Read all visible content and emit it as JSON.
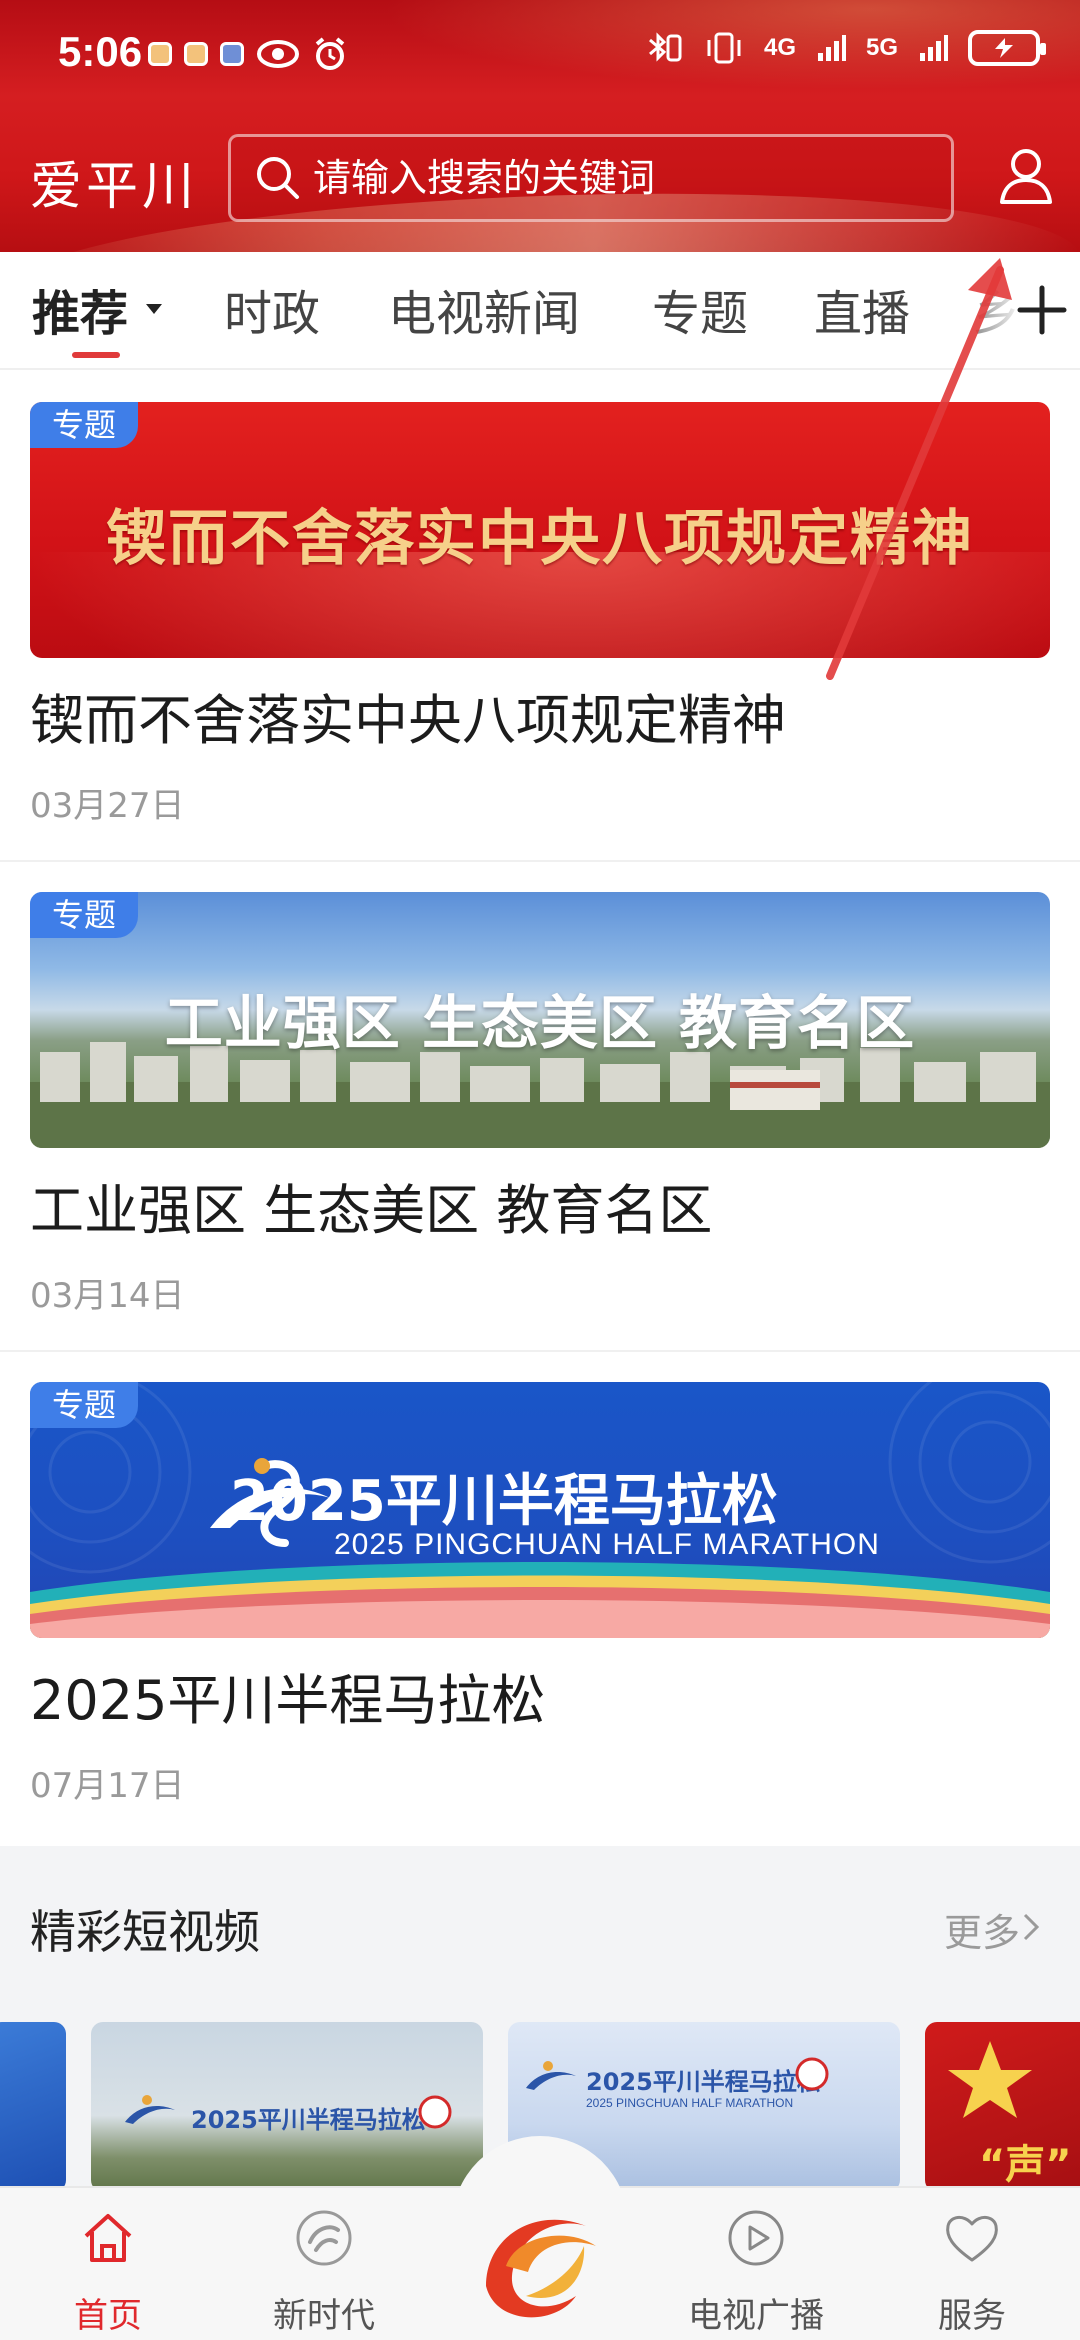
{
  "status_bar": {
    "time": "5:06",
    "network_1": "4G",
    "network_2": "5G"
  },
  "header": {
    "app_title": "爱平川",
    "search_placeholder": "请输入搜索的关键词"
  },
  "tabs": [
    {
      "label": "推荐",
      "active": true
    },
    {
      "label": "时政",
      "active": false
    },
    {
      "label": "电视新闻",
      "active": false
    },
    {
      "label": "专题",
      "active": false
    },
    {
      "label": "直播",
      "active": false
    },
    {
      "label": "乡",
      "active": false
    }
  ],
  "articles": [
    {
      "badge": "专题",
      "banner_text": "锲而不舍落实中央八项规定精神",
      "title": "锲而不舍落实中央八项规定精神",
      "date": "03月27日"
    },
    {
      "badge": "专题",
      "banner_text": "工业强区 生态美区 教育名区",
      "title": "工业强区  生态美区  教育名区",
      "date": "03月14日"
    },
    {
      "badge": "专题",
      "banner_text": "2025平川半程马拉松",
      "banner_subtext": "2025 PINGCHUAN HALF MARATHON",
      "title": "2025平川半程马拉松",
      "date": "07月17日"
    }
  ],
  "short_videos": {
    "title": "精彩短视频",
    "more": "更多",
    "thumbs": [
      {
        "label": "2025平川半程马拉松"
      },
      {
        "label": "2025平川半程马拉松",
        "sub": "2025 PINGCHUAN HALF MARATHON"
      },
      {
        "label": "“声”"
      }
    ]
  },
  "bottom_nav": [
    {
      "label": "首页",
      "icon": "home-icon",
      "active": true
    },
    {
      "label": "新时代",
      "icon": "new-era-icon",
      "active": false
    },
    {
      "label": "",
      "icon": "center-logo-icon",
      "active": false
    },
    {
      "label": "电视广播",
      "icon": "play-icon",
      "active": false
    },
    {
      "label": "服务",
      "icon": "heart-icon",
      "active": false
    }
  ],
  "colors": {
    "header_red": "#cf1719",
    "accent_red": "#e0282c",
    "badge_blue": "#3f7ee8",
    "date_gray": "#9a9a9a"
  }
}
